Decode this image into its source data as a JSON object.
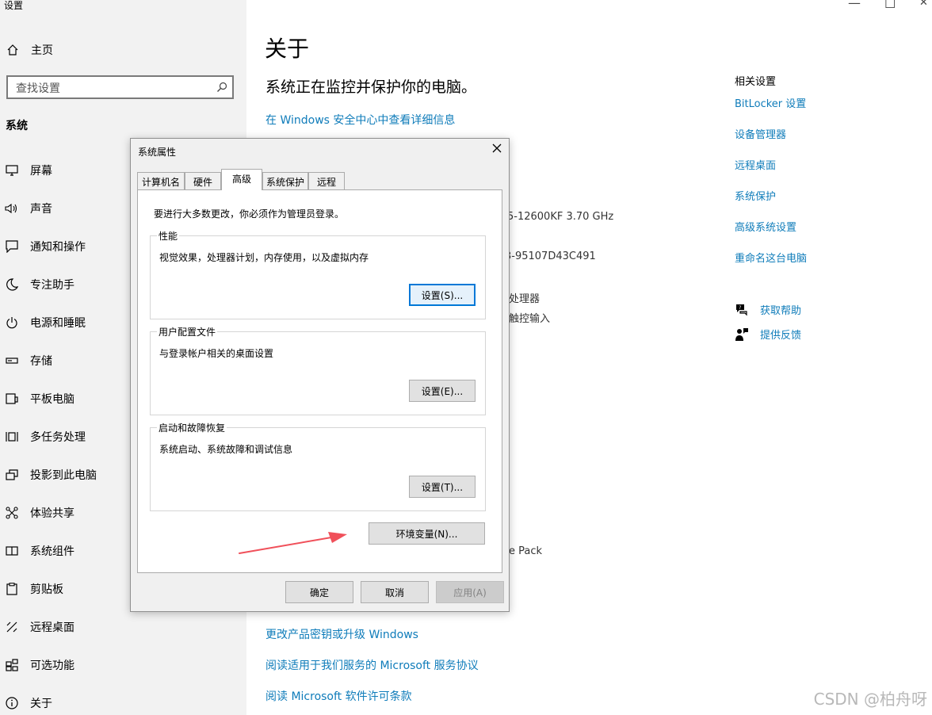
{
  "app": {
    "title": "设置"
  },
  "window_controls": {
    "minimize": "—",
    "maximize": "☐",
    "close": "✕"
  },
  "sidebar": {
    "home": "主页",
    "search_placeholder": "查找设置",
    "section": "系统",
    "items": [
      {
        "label": "屏幕",
        "icon": "display-icon"
      },
      {
        "label": "声音",
        "icon": "speaker-icon"
      },
      {
        "label": "通知和操作",
        "icon": "notification-icon"
      },
      {
        "label": "专注助手",
        "icon": "moon-icon"
      },
      {
        "label": "电源和睡眠",
        "icon": "power-icon"
      },
      {
        "label": "存储",
        "icon": "storage-icon"
      },
      {
        "label": "平板电脑",
        "icon": "tablet-icon"
      },
      {
        "label": "多任务处理",
        "icon": "multitask-icon"
      },
      {
        "label": "投影到此电脑",
        "icon": "project-icon"
      },
      {
        "label": "体验共享",
        "icon": "share-icon"
      },
      {
        "label": "系统组件",
        "icon": "components-icon"
      },
      {
        "label": "剪贴板",
        "icon": "clipboard-icon"
      },
      {
        "label": "远程桌面",
        "icon": "remote-icon"
      },
      {
        "label": "可选功能",
        "icon": "optional-features-icon"
      },
      {
        "label": "关于",
        "icon": "info-icon"
      }
    ]
  },
  "main": {
    "title": "关于",
    "protect_text": "系统正在监控并保护你的电脑。",
    "security_link": "在 Windows 安全中心中查看详细信息",
    "fragments": {
      "cpu": "5-12600KF   3.70 GHz",
      "device_id": "3-95107D43C491",
      "processor": "处理器",
      "touch": "触控输入",
      "pack": "e Pack"
    },
    "bottom_links": [
      "更改产品密钥或升级 Windows",
      "阅读适用于我们服务的 Microsoft 服务协议",
      "阅读 Microsoft 软件许可条款"
    ]
  },
  "related": {
    "heading": "相关设置",
    "links": [
      "BitLocker 设置",
      "设备管理器",
      "远程桌面",
      "系统保护",
      "高级系统设置",
      "重命名这台电脑"
    ],
    "help": "获取帮助",
    "feedback": "提供反馈"
  },
  "dialog": {
    "title": "系统属性",
    "tabs": [
      "计算机名",
      "硬件",
      "高级",
      "系统保护",
      "远程"
    ],
    "active_tab": "高级",
    "admin_notice": "要进行大多数更改，你必须作为管理员登录。",
    "groups": [
      {
        "title": "性能",
        "desc": "视觉效果，处理器计划，内存使用，以及虚拟内存",
        "button": "设置(S)..."
      },
      {
        "title": "用户配置文件",
        "desc": "与登录帐户相关的桌面设置",
        "button": "设置(E)..."
      },
      {
        "title": "启动和故障恢复",
        "desc": "系统启动、系统故障和调试信息",
        "button": "设置(T)..."
      }
    ],
    "env_button": "环境变量(N)...",
    "ok": "确定",
    "cancel": "取消",
    "apply": "应用(A)"
  },
  "watermark": "CSDN @柏舟呀",
  "colors": {
    "link": "#0f7cba",
    "sidebar_bg": "#f2f2f2",
    "dialog_bg": "#f0f0f0",
    "arrow": "#f0505a"
  }
}
